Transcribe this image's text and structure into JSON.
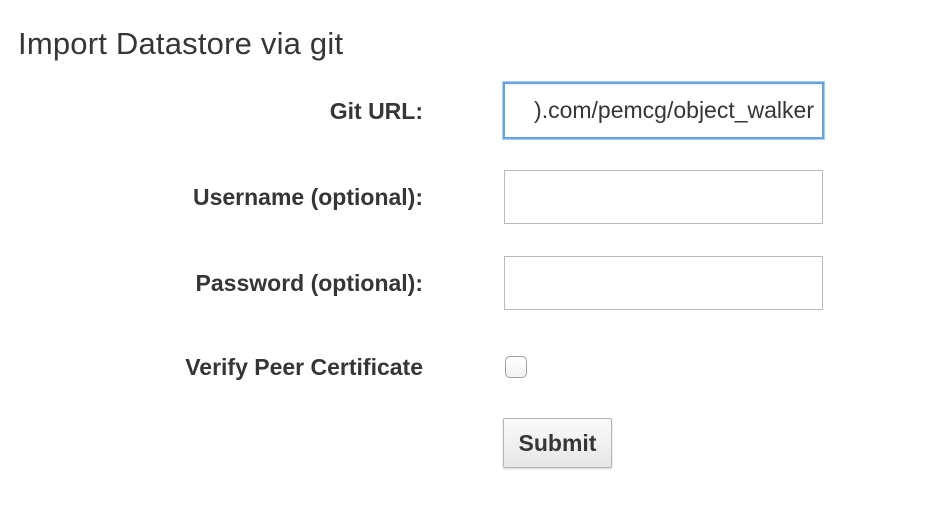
{
  "page": {
    "title": "Import Datastore via git"
  },
  "form": {
    "git_url": {
      "label": "Git URL:",
      "value": ").com/pemcg/object_walker",
      "focused": true
    },
    "username": {
      "label": "Username (optional):",
      "value": "",
      "placeholder": ""
    },
    "password": {
      "label": "Password (optional):",
      "value": "",
      "placeholder": ""
    },
    "verify_peer": {
      "label": "Verify Peer Certificate",
      "checked": false
    },
    "submit_label": "Submit"
  },
  "colors": {
    "text": "#363636",
    "focus_border": "#66a3e0",
    "input_border": "#bbbbbb"
  }
}
